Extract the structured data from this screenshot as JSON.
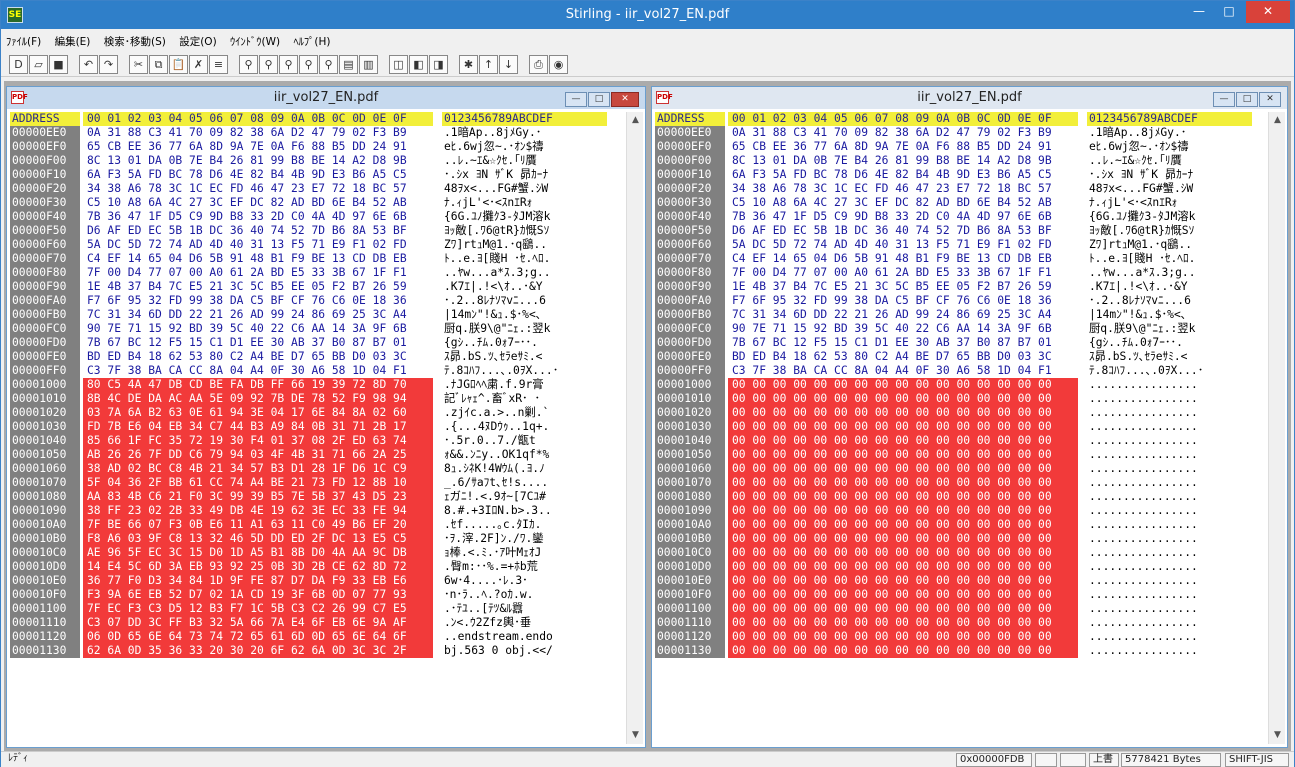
{
  "app": {
    "title": "Stirling - iir_vol27_EN.pdf",
    "icon_label": "SE"
  },
  "menu": [
    "ﾌｧｲﾙ(F)",
    "編集(E)",
    "検索･移動(S)",
    "設定(O)",
    "ｳｲﾝﾄﾞｳ(W)",
    "ﾍﾙﾌﾟ(H)"
  ],
  "toolbar": [
    "new-icon",
    "open-icon",
    "save-icon",
    "undo-icon",
    "redo-icon",
    "cut-icon",
    "copy-icon",
    "paste-icon",
    "delete-icon",
    "list-icon",
    "find-icon",
    "find-next-icon",
    "find-prev-icon",
    "find-hex-icon",
    "find-text-icon",
    "compare-icon",
    "bookmark-icon",
    "jump-icon",
    "jump-prev-icon",
    "jump-next-icon",
    "mark-icon",
    "bit-up-icon",
    "bit-down-icon",
    "print-icon",
    "settings-icon"
  ],
  "left": {
    "title": "iir_vol27_EN.pdf",
    "header": {
      "address": "ADDRESS",
      "hex": "00 01 02 03 04 05 06 07 08 09 0A 0B 0C 0D 0E 0F",
      "chars": "0123456789ABCDEF"
    },
    "rows": [
      {
        "a": "00000EE0",
        "h": "0A 31 88 C3 41 70 09 82 38 6A D2 47 79 02 F3 B9",
        "c": ".1暗Ap..8jﾒGy.･"
      },
      {
        "a": "00000EF0",
        "h": "65 CB EE 36 77 6A 8D 9A 7E 0A F6 88 B5 DD 24 91",
        "c": "eﾋ.6wj忽~.･ｵﾝ$禱"
      },
      {
        "a": "00000F00",
        "h": "8C 13 01 DA 0B 7E B4 26 81 99 B8 BE 14 A2 D8 9B",
        "c": "..ﾚ.~ｴ&☆ｸｾ.｢ﾘ贋"
      },
      {
        "a": "00000F10",
        "h": "6A F3 5A FD BC 78 D6 4E 82 B4 4B 9D E3 B6 A5 C5",
        "c": "･.ｼx ﾖN ｻﾞK 昴ｶｰﾅ"
      },
      {
        "a": "00000F20",
        "h": "34 38 A6 78 3C 1C EC FD 46 47 23 E7 72 18 BC 57",
        "c": "48ｦx<...FG#蟹.ｼW"
      },
      {
        "a": "00000F30",
        "h": "C5 10 A8 6A 4C 27 3C EF DC 82 AD BD 6E B4 52 AB",
        "c": "ﾅ.ｨjL'<･<ｽnｴRｫ"
      },
      {
        "a": "00000F40",
        "h": "7B 36 47 1F D5 C9 9D B8 33 2D C0 4A 4D 97 6E 6B",
        "c": "{6G.ﾕﾉ攤ｸ3-ﾀJM溶k"
      },
      {
        "a": "00000F50",
        "h": "D6 AF ED EC 5B 1B DC 36 40 74 52 7D B6 8A 53 BF",
        "c": "ﾖｯ敵[.ﾜ6@tR}ｶ慨Sｿ"
      },
      {
        "a": "00000F60",
        "h": "5A DC 5D 72 74 AD 4D 40 31 13 F5 71 E9 F1 02 FD",
        "c": "Zﾜ]rtｭM@1.･q鷂.."
      },
      {
        "a": "00000F70",
        "h": "C4 EF 14 65 04 D6 5B 91 48 B1 F9 BE 13 CD DB EB",
        "c": "ﾄ..e.ﾖ[賤H ･ｾ.ﾍﾛ."
      },
      {
        "a": "00000F80",
        "h": "7F 00 D4 77 07 00 A0 61 2A BD E5 33 3B 67 1F F1",
        "c": "..ﾔw...a*ｽ.3;g.."
      },
      {
        "a": "00000F90",
        "h": "1E 4B 37 B4 7C E5 21 3C 5C B5 EE 05 F2 B7 26 59",
        "c": ".K7ｴ|.!<\\ｵ..･&Y"
      },
      {
        "a": "00000FA0",
        "h": "F7 6F 95 32 FD 99 38 DA C5 BF CF 76 C6 0E 18 36",
        "c": "･.2..8ﾚﾅｿﾏvﾆ...6"
      },
      {
        "a": "00000FB0",
        "h": "7C 31 34 6D DD 22 21 26 AD 99 24 86 69 25 3C A4",
        "c": "|14mﾝ\"!&ｭ.$･%<､"
      },
      {
        "a": "00000FC0",
        "h": "90 7E 71 15 92 BD 39 5C 40 22 C6 AA 14 3A 9F 6B",
        "c": "厨q.朕9\\@\"ﾆｪ.:翌k"
      },
      {
        "a": "00000FD0",
        "h": "7B 67 BC 12 F5 15 C1 D1 EE 30 AB 37 B0 87 B7 01",
        "c": "{gｼ..ﾁﾑ.0ｫ7ｰ･･."
      },
      {
        "a": "00000FE0",
        "h": "BD ED B4 18 62 53 80 C2 A4 BE D7 65 BB D0 03 3C",
        "c": "ｽ昴.bS.ﾂ､ｾﾗeｻﾐ.<"
      },
      {
        "a": "00000FF0",
        "h": "C3 7F 38 BA CA CC 8A 04 A4 0F 30 A6 58 1D 04 F1",
        "c": "ﾃ.8ｺﾊﾌ...､.0ｦX...･"
      },
      {
        "a": "00001000",
        "h": "80 C5 4A 47 DB CD BE FA DB FF 66 19 39 72 8D 70",
        "c": ".ﾅJGﾛﾍﾍ粛.f.9r膏"
      },
      {
        "a": "00001010",
        "h": "8B 4C DE DA AC AA 5E 09 92 7B DE 78 52 F9 98 94",
        "c": "記ﾞﾚｬｪ^.畜ﾞxR･ ･"
      },
      {
        "a": "00001020",
        "h": "03 7A 6A B2 63 0E 61 94 3E 04 17 6E 84 8A 02 60",
        "c": ".zjｲc.a.>..n剿.`"
      },
      {
        "a": "00001030",
        "h": "FD 7B E6 04 EB 34 C7 44 B3 A9 84 0B 31 71 2B 17",
        "c": ".{...4ﾇDｳｩ..1q+."
      },
      {
        "a": "00001040",
        "h": "85 66 1F FC 35 72 19 30 F4 01 37 08 2F ED 63 74",
        "c": "･.5r.0..7./甑t"
      },
      {
        "a": "00001050",
        "h": "AB 26 26 7F DD C6 79 94 03 4F 4B 31 71 66 2A 25",
        "c": "ｫ&&.ﾝﾆy..OK1qf*%"
      },
      {
        "a": "00001060",
        "h": "38 AD 02 BC C8 4B 21 34 57 B3 D1 28 1F D6 1C C9",
        "c": "8ｭ.ｼﾈK!4Wｳﾑ(.ﾖ.ﾉ"
      },
      {
        "a": "00001070",
        "h": "5F 04 36 2F BB 61 CC 74 A4 BE 21 73 FD 12 8B 10",
        "c": "_.6/ｻaﾌt､ｾ!s...."
      },
      {
        "a": "00001080",
        "h": "AA 83 4B C6 21 F0 3C 99 39 B5 7E 5B 37 43 D5 23",
        "c": "ｪガﾆ!.<.9ｵ~[7Cﾕ#"
      },
      {
        "a": "00001090",
        "h": "38 FF 23 02 2B 33 49 DB 4E 19 62 3E EC 33 FE 94",
        "c": "8.#.+3IﾛN.b>.3.."
      },
      {
        "a": "000010A0",
        "h": "7F BE 66 07 F3 0B E6 11 A1 63 11 C0 49 B6 EF 20",
        "c": ".ｾf.....｡c.ﾀIｶ. "
      },
      {
        "a": "000010B0",
        "h": "F8 A6 03 9F C8 13 32 46 5D DD ED 2F DC 13 E5 C5",
        "c": "･ｦ.滓.2F]ﾝ./ﾜ.鑾"
      },
      {
        "a": "000010C0",
        "h": "AE 96 5F EC 3C 15 D0 1D A5 B1 8B D0 4A AA 9C DB",
        "c": "ｮ棒.<.ﾐ.･ｱ叶MｪｵJ"
      },
      {
        "a": "000010D0",
        "h": "14 E4 5C 6D 3A EB 93 92 25 0B 3D 2B CE 62 8D 72",
        "c": ".臀m:･･%.=+ﾎb荒"
      },
      {
        "a": "000010E0",
        "h": "36 77 F0 D3 34 84 1D 9F FE 87 D7 DA F9 33 EB E6",
        "c": "6w･4....･ﾚ.3･"
      },
      {
        "a": "000010F0",
        "h": "F3 9A 6E EB 52 D7 02 1A CD 19 3F 6B 0D 07 77 93",
        "c": "･n･ﾗ..ﾍ.?oｶ.w."
      },
      {
        "a": "00001100",
        "h": "7F EC F3 C3 D5 12 B3 F7 1C 5B C3 C2 26 99 C7 E5",
        "c": ".･ﾃﾕ..[ﾃﾂ&ﾙ囂"
      },
      {
        "a": "00001110",
        "h": "C3 07 DD 3C FF B3 32 5A 66 7A E4 6F EB 6E 9A AF",
        "c": ".ﾝ<.ｳ2Zfz輿･垂"
      },
      {
        "a": "00001120",
        "h": "06 0D 65 6E 64 73 74 72 65 61 6D 0D 65 6E 64 6F",
        "c": "..endstream.endo"
      },
      {
        "a": "00001130",
        "h": "62 6A 0D 35 36 33 20 30 20 6F 62 6A 0D 3C 3C 2F",
        "c": "bj.563 0 obj.<</"
      }
    ]
  },
  "right": {
    "title": "iir_vol27_EN.pdf",
    "header": {
      "address": "ADDRESS",
      "hex": "00 01 02 03 04 05 06 07 08 09 0A 0B 0C 0D 0E 0F",
      "chars": "0123456789ABCDEF"
    },
    "zero_hex": "00 00 00 00 00 00 00 00 00 00 00 00 00 00 00 00",
    "zero_chars": "................",
    "rows": [
      {
        "a": "00000EE0",
        "h": "0A 31 88 C3 41 70 09 82 38 6A D2 47 79 02 F3 B9",
        "c": ".1暗Ap..8jﾒGy.･"
      },
      {
        "a": "00000EF0",
        "h": "65 CB EE 36 77 6A 8D 9A 7E 0A F6 88 B5 DD 24 91",
        "c": "eﾋ.6wj忽~.･ｵﾝ$禱"
      },
      {
        "a": "00000F00",
        "h": "8C 13 01 DA 0B 7E B4 26 81 99 B8 BE 14 A2 D8 9B",
        "c": "..ﾚ.~ｴ&☆ｸｾ.｢ﾘ贋"
      },
      {
        "a": "00000F10",
        "h": "6A F3 5A FD BC 78 D6 4E 82 B4 4B 9D E3 B6 A5 C5",
        "c": "･.ｼx ﾖN ｻﾞK 昴ｶｰﾅ"
      },
      {
        "a": "00000F20",
        "h": "34 38 A6 78 3C 1C EC FD 46 47 23 E7 72 18 BC 57",
        "c": "48ｦx<...FG#蟹.ｼW"
      },
      {
        "a": "00000F30",
        "h": "C5 10 A8 6A 4C 27 3C EF DC 82 AD BD 6E B4 52 AB",
        "c": "ﾅ.ｨjL'<･<ｽnｴRｫ"
      },
      {
        "a": "00000F40",
        "h": "7B 36 47 1F D5 C9 9D B8 33 2D C0 4A 4D 97 6E 6B",
        "c": "{6G.ﾕﾉ攤ｸ3-ﾀJM溶k"
      },
      {
        "a": "00000F50",
        "h": "D6 AF ED EC 5B 1B DC 36 40 74 52 7D B6 8A 53 BF",
        "c": "ﾖｯ敵[.ﾜ6@tR}ｶ慨Sｿ"
      },
      {
        "a": "00000F60",
        "h": "5A DC 5D 72 74 AD 4D 40 31 13 F5 71 E9 F1 02 FD",
        "c": "Zﾜ]rtｭM@1.･q鷂.."
      },
      {
        "a": "00000F70",
        "h": "C4 EF 14 65 04 D6 5B 91 48 B1 F9 BE 13 CD DB EB",
        "c": "ﾄ..e.ﾖ[賤H ･ｾ.ﾍﾛ."
      },
      {
        "a": "00000F80",
        "h": "7F 00 D4 77 07 00 A0 61 2A BD E5 33 3B 67 1F F1",
        "c": "..ﾔw...a*ｽ.3;g.."
      },
      {
        "a": "00000F90",
        "h": "1E 4B 37 B4 7C E5 21 3C 5C B5 EE 05 F2 B7 26 59",
        "c": ".K7ｴ|.!<\\ｵ..･&Y"
      },
      {
        "a": "00000FA0",
        "h": "F7 6F 95 32 FD 99 38 DA C5 BF CF 76 C6 0E 18 36",
        "c": "･.2..8ﾚﾅｿﾏvﾆ...6"
      },
      {
        "a": "00000FB0",
        "h": "7C 31 34 6D DD 22 21 26 AD 99 24 86 69 25 3C A4",
        "c": "|14mﾝ\"!&ｭ.$･%<､"
      },
      {
        "a": "00000FC0",
        "h": "90 7E 71 15 92 BD 39 5C 40 22 C6 AA 14 3A 9F 6B",
        "c": "厨q.朕9\\@\"ﾆｪ.:翌k"
      },
      {
        "a": "00000FD0",
        "h": "7B 67 BC 12 F5 15 C1 D1 EE 30 AB 37 B0 87 B7 01",
        "c": "{gｼ..ﾁﾑ.0ｫ7ｰ･･."
      },
      {
        "a": "00000FE0",
        "h": "BD ED B4 18 62 53 80 C2 A4 BE D7 65 BB D0 03 3C",
        "c": "ｽ昴.bS.ﾂ､ｾﾗeｻﾐ.<"
      },
      {
        "a": "00000FF0",
        "h": "C3 7F 38 BA CA CC 8A 04 A4 0F 30 A6 58 1D 04 F1",
        "c": "ﾃ.8ｺﾊﾌ...､.0ｦX...･"
      }
    ],
    "zero_addresses": [
      "00001000",
      "00001010",
      "00001020",
      "00001030",
      "00001040",
      "00001050",
      "00001060",
      "00001070",
      "00001080",
      "00001090",
      "000010A0",
      "000010B0",
      "000010C0",
      "000010D0",
      "000010E0",
      "000010F0",
      "00001100",
      "00001110",
      "00001120",
      "00001130"
    ]
  },
  "status": {
    "mode": "ﾚﾃﾞｨ",
    "offset": "0x00000FDB",
    "overwrite": "上書",
    "size": "5778421 Bytes",
    "encoding": "SHIFT-JIS"
  },
  "colors": {
    "diff_highlight": "#f23a3a",
    "header": "#f2ef3a",
    "address_bg": "#808080"
  }
}
